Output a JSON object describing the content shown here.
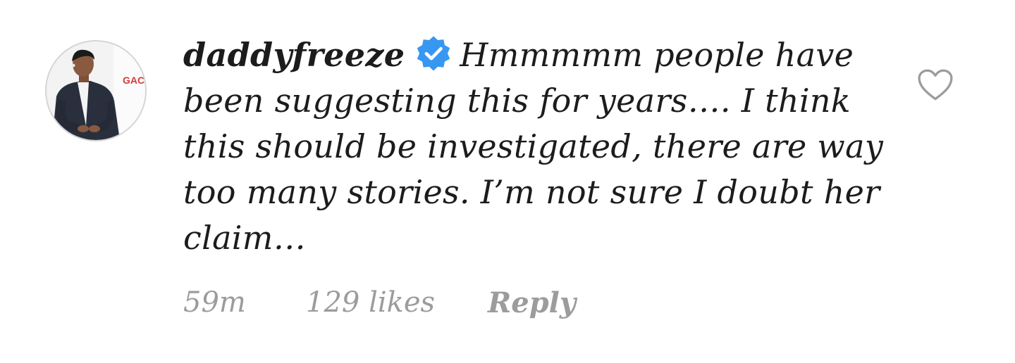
{
  "comment": {
    "username": "daddyfreeze",
    "verified": true,
    "text": "Hmmmmm people have been suggesting this for years…. I think this should be investigated, there are way too many stories. I’m not sure I doubt her claim…",
    "avatar_logo_text": "GACM",
    "time": "59m",
    "likes": "129 likes",
    "reply_label": "Reply"
  },
  "icons": {
    "verified": "verified-badge-icon",
    "like": "heart-outline-icon"
  },
  "colors": {
    "verified_blue": "#3897f0",
    "meta_gray": "#9c9c9c",
    "text": "#1c1c1c",
    "heart_outline": "#9c9c9c"
  }
}
